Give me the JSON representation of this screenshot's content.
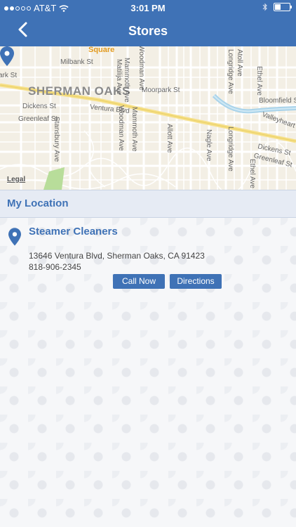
{
  "status_bar": {
    "carrier": "AT&T",
    "time": "3:01 PM",
    "signal_dots_filled": 2,
    "signal_dots_total": 5
  },
  "nav": {
    "title": "Stores",
    "back_icon": "chevron-left-icon"
  },
  "map": {
    "labels": {
      "square": "Square",
      "milbank": "Milbank St",
      "sherman_oaks": "SHERMAN OAKS",
      "dickens_w": "Dickens St",
      "greenleaf_w": "Greenleaf St",
      "ventura": "Ventura Blvd",
      "moorpark": "Moorpark St",
      "bloomfield": "Bloomfield S",
      "valleyheart": "Valleyheart Dr",
      "dickens_e": "Dickens St",
      "greenleaf_e": "Greenleaf St",
      "park": "ark St",
      "mammoth": "Mammoth Ave",
      "woodman": "Woodman Ave",
      "matilija": "Matilija Ave",
      "stansbury": "Stansbury Ave",
      "allott": "Allott Ave",
      "nagle": "Nagle Ave",
      "longridge_n": "Longridge Ave",
      "longridge_s": "Longridge Ave",
      "atoll": "Atoll Ave",
      "ethel_n": "Ethel Ave",
      "ethel_s": "Ethel Ave"
    },
    "legal": "Legal",
    "pin_icon": "map-pin-icon"
  },
  "section": {
    "title": "My Location"
  },
  "store": {
    "name": "Steamer Cleaners",
    "address": "13646 Ventura Blvd, Sherman Oaks, CA 91423",
    "phone": "818-906-2345",
    "call_label": "Call Now",
    "directions_label": "Directions",
    "pin_icon": "location-pin-icon"
  },
  "colors": {
    "primary": "#3f72b6",
    "section_bg": "#e6ebf4"
  }
}
